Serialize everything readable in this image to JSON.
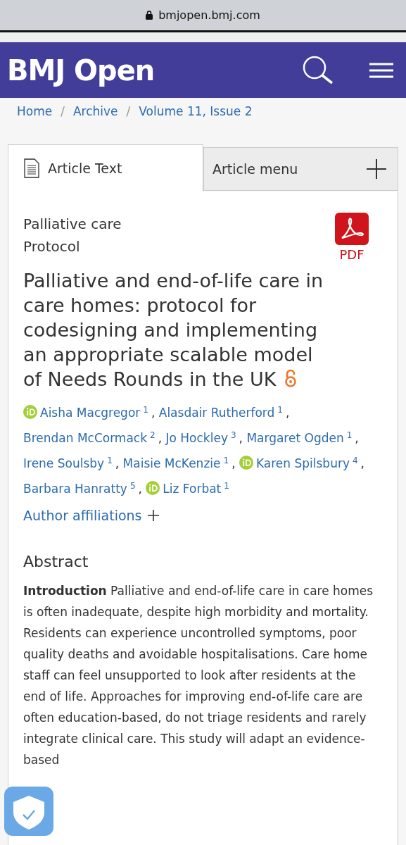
{
  "browser": {
    "url": "bmjopen.bmj.com"
  },
  "header": {
    "logo": "BMJ Open"
  },
  "breadcrumbs": [
    "Home",
    "Archive",
    "Volume 11, Issue 2"
  ],
  "breadcrumb_separator": "/",
  "tabs": [
    {
      "label": "Article Text",
      "selected": true
    },
    {
      "label": "Article menu",
      "selected": false
    }
  ],
  "article": {
    "subject": "Palliative care",
    "type": "Protocol",
    "pdf_label": "PDF",
    "title": "Palliative and end-of-life care in care homes: protocol for codesigning and implementing an appropriate scalable model of Needs Rounds in the UK",
    "open_access": true,
    "authors": [
      {
        "name": "Aisha Macgregor",
        "aff": "1",
        "orcid": true
      },
      {
        "name": "Alasdair Rutherford",
        "aff": "1",
        "orcid": false
      },
      {
        "name": "Brendan McCormack",
        "aff": "2",
        "orcid": false
      },
      {
        "name": "Jo Hockley",
        "aff": "3",
        "orcid": false
      },
      {
        "name": "Margaret Ogden",
        "aff": "1",
        "orcid": false
      },
      {
        "name": "Irene Soulsby",
        "aff": "1",
        "orcid": false
      },
      {
        "name": "Maisie McKenzie",
        "aff": "1",
        "orcid": false
      },
      {
        "name": "Karen Spilsbury",
        "aff": "4",
        "orcid": true
      },
      {
        "name": "Barbara Hanratty",
        "aff": "5",
        "orcid": false
      },
      {
        "name": "Liz Forbat",
        "aff": "1",
        "orcid": true
      }
    ],
    "author_separator": ",",
    "affiliations_link": "Author affiliations",
    "abstract_heading": "Abstract",
    "abstract": "**Introduction** Palliative and end-of-life care in care homes is often inadequate, despite high morbidity and mortality. Residents can experience uncontrolled symptoms, poor quality deaths and avoidable hospitalisations. Care home staff can feel unsupported to look after residents at the end of life. Approaches for improving end-of-life care are often education-based, do not triage residents and rarely integrate clinical care. This study will adapt an evidence-based"
  }
}
